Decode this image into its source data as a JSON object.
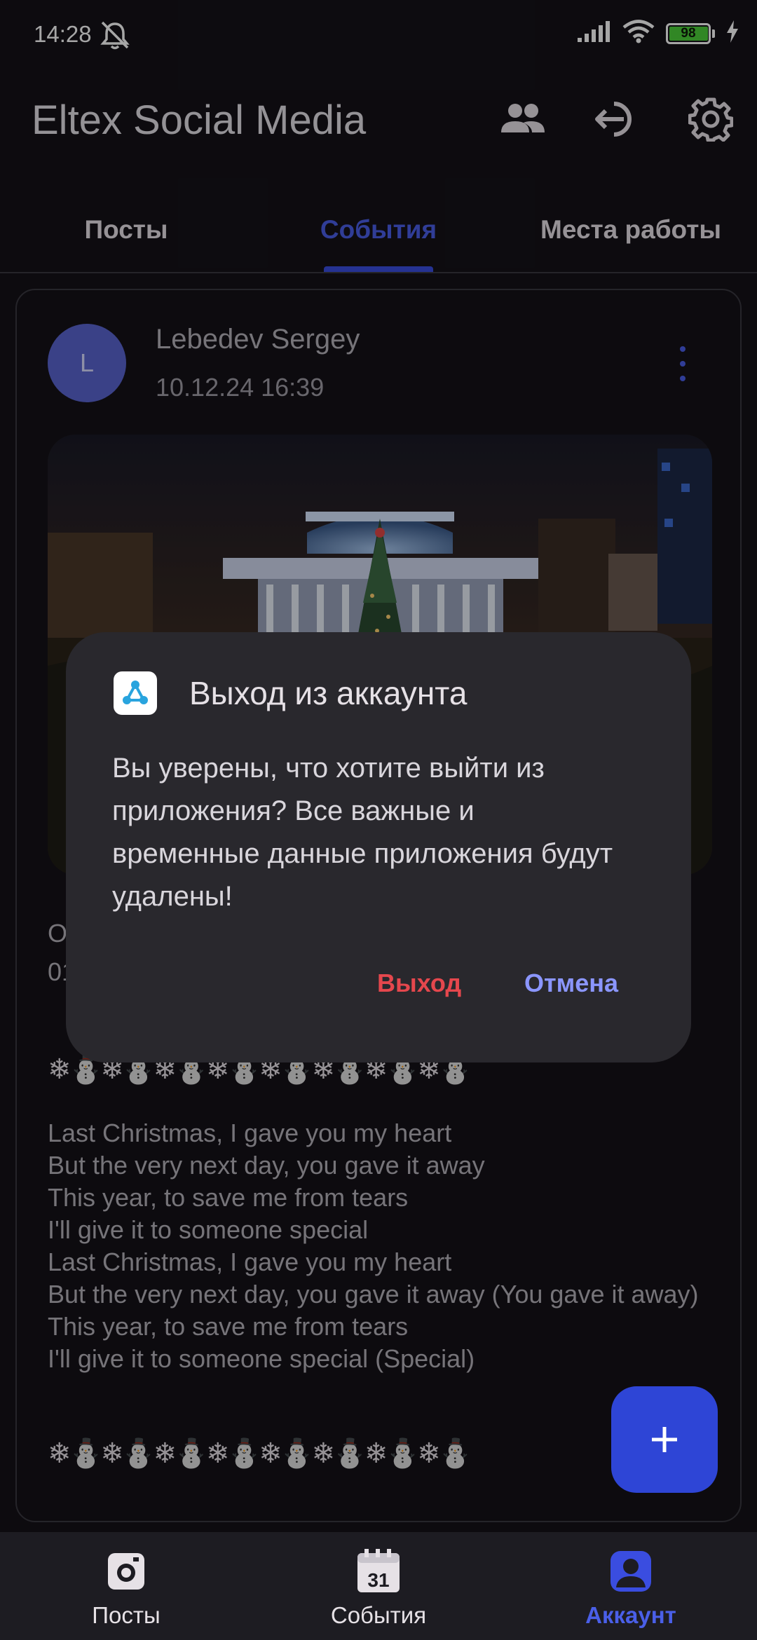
{
  "status_bar": {
    "time": "14:28",
    "battery": "98",
    "battery_level": 0.98
  },
  "app_bar": {
    "title": "Eltex Social Media",
    "icons": [
      "people-icon",
      "logout-icon",
      "settings-icon"
    ]
  },
  "tabs": [
    {
      "label": "Посты",
      "active": false
    },
    {
      "label": "События",
      "active": true
    },
    {
      "label": "Места работы",
      "active": false
    }
  ],
  "post": {
    "author": "Lebedev Sergey",
    "avatar_letter": "L",
    "date": "10.12.24 16:39",
    "event_type_partial": "О",
    "event_date_partial": "01",
    "decoration": "❄⛄❄⛄❄⛄❄⛄❄⛄❄⛄❄⛄❄⛄",
    "text": "Last Christmas, I gave you my heart\nBut the very next day, you gave it away\nThis year, to save me from tears\nI'll give it to someone special\nLast Christmas, I gave you my heart\nBut the very next day, you gave it away (You gave it away)\nThis year, to save me from tears\nI'll give it to someone special (Special)"
  },
  "dialog": {
    "title": "Выход из аккаунта",
    "message": "Вы уверены, что хотите выйти из приложения? Все важные и временные данные приложения будут удалены!",
    "exit_label": "Выход",
    "cancel_label": "Отмена"
  },
  "fab": {
    "icon": "plus-icon"
  },
  "bottom_nav": [
    {
      "label": "Посты",
      "icon": "camera-icon",
      "active": false
    },
    {
      "label": "События",
      "icon": "calendar-icon",
      "calendar_day": "31",
      "active": false
    },
    {
      "label": "Аккаунт",
      "icon": "account-icon",
      "active": true
    }
  ],
  "colors": {
    "background": "#141218",
    "accent": "#3a4de0",
    "dialog": "#29282d",
    "danger": "#e5474d",
    "fab": "#2e45d6"
  }
}
